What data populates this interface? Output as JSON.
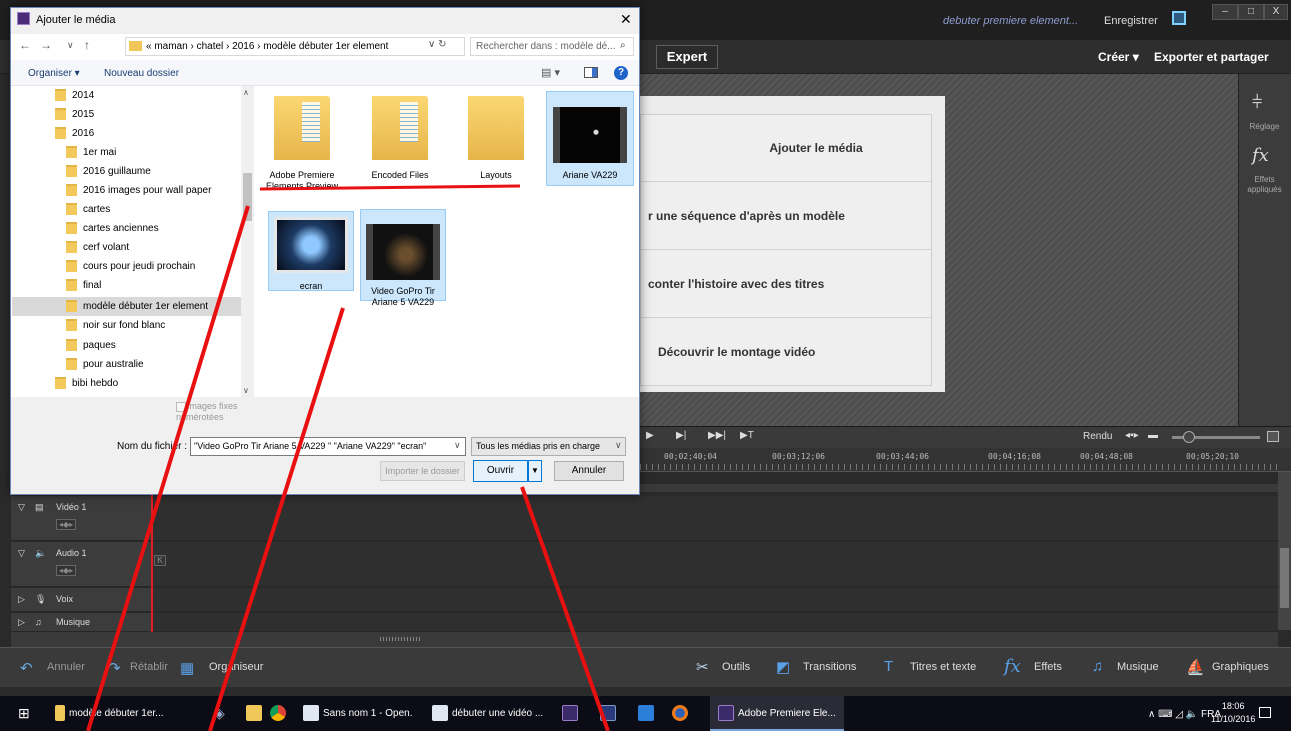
{
  "app": {
    "doc_title": "debuter premiere element...",
    "save": "Enregistrer",
    "win_min": "–",
    "win_max": "□",
    "win_close": "X",
    "mode": "Expert",
    "create": "Créer ▾",
    "export": "Exporter et partager",
    "menu_items": [
      "Ajouter le média",
      "r une séquence d'après un modèle",
      "conter l'histoire avec des titres",
      "Découvrir le montage vidéo"
    ],
    "right_panel": {
      "adjust_label": "Réglage",
      "effects_label_1": "Effets",
      "effects_label_2": "appliqués"
    },
    "render": "Rendu",
    "timecodes": [
      "00;02;40;04",
      "00;03;12;06",
      "00;03;44;06",
      "00;04;16;08",
      "00;04;48;08",
      "00;05;20;10"
    ],
    "tracks": [
      {
        "name": "Vidéo 1"
      },
      {
        "name": "Audio 1"
      },
      {
        "name": "Voix"
      },
      {
        "name": "Musique"
      }
    ],
    "action_bar": {
      "undo": "Annuler",
      "redo": "Rétablir",
      "organizer": "Organiseur",
      "tools": "Outils",
      "transitions": "Transitions",
      "titles": "Titres et texte",
      "effects": "Effets",
      "music": "Musique",
      "graphics": "Graphiques"
    }
  },
  "taskbar": {
    "items": [
      "modèle débuter 1er...",
      "Sans nom 1 - Open...",
      "débuter une vidéo ...",
      "Adobe Premiere Ele..."
    ],
    "lang": "FRA",
    "time": "18:06",
    "date": "11/10/2016"
  },
  "dialog": {
    "title": "Ajouter le média",
    "address": "« maman › chatel › 2016 › modèle débuter 1er element",
    "search_placeholder": "Rechercher dans : modèle dé...",
    "organize": "Organiser ▾",
    "new_folder": "Nouveau dossier",
    "tree": [
      {
        "label": "2014",
        "level": 1
      },
      {
        "label": "2015",
        "level": 1
      },
      {
        "label": "2016",
        "level": 1
      },
      {
        "label": "1er mai",
        "level": 2
      },
      {
        "label": "2016 guillaume",
        "level": 2
      },
      {
        "label": "2016 images pour wall paper",
        "level": 2
      },
      {
        "label": "cartes",
        "level": 2
      },
      {
        "label": "cartes anciennes",
        "level": 2
      },
      {
        "label": "cerf volant",
        "level": 2
      },
      {
        "label": "cours pour jeudi prochain",
        "level": 2
      },
      {
        "label": "final",
        "level": 2
      },
      {
        "label": "modèle débuter 1er element",
        "level": 2,
        "selected": true
      },
      {
        "label": "noir sur fond blanc",
        "level": 2
      },
      {
        "label": "paques",
        "level": 2
      },
      {
        "label": "pour australie",
        "level": 2
      },
      {
        "label": "bibi hebdo",
        "level": 1
      }
    ],
    "files": [
      {
        "label": "Adobe Premiere Elements Preview Files",
        "kind": "folder"
      },
      {
        "label": "Encoded Files",
        "kind": "folder"
      },
      {
        "label": "Layouts",
        "kind": "folder"
      },
      {
        "label": "Ariane VA229",
        "kind": "video",
        "selected": true
      },
      {
        "label": "ecran",
        "kind": "image",
        "selected": true
      },
      {
        "label": "Video GoPro Tir Ariane 5 VA229",
        "kind": "video",
        "selected": true
      }
    ],
    "still_images_1": "Images fixes",
    "still_images_2": "numérotées",
    "filename_label": "Nom du fichier :",
    "filename_value": "\"Video GoPro Tir Ariane 5 VA229 \" \"Ariane VA229\" \"ecran\"",
    "filetype": "Tous les médias pris en charge",
    "import_folder": "Importer le dossier",
    "open": "Ouvrir",
    "cancel": "Annuler"
  }
}
